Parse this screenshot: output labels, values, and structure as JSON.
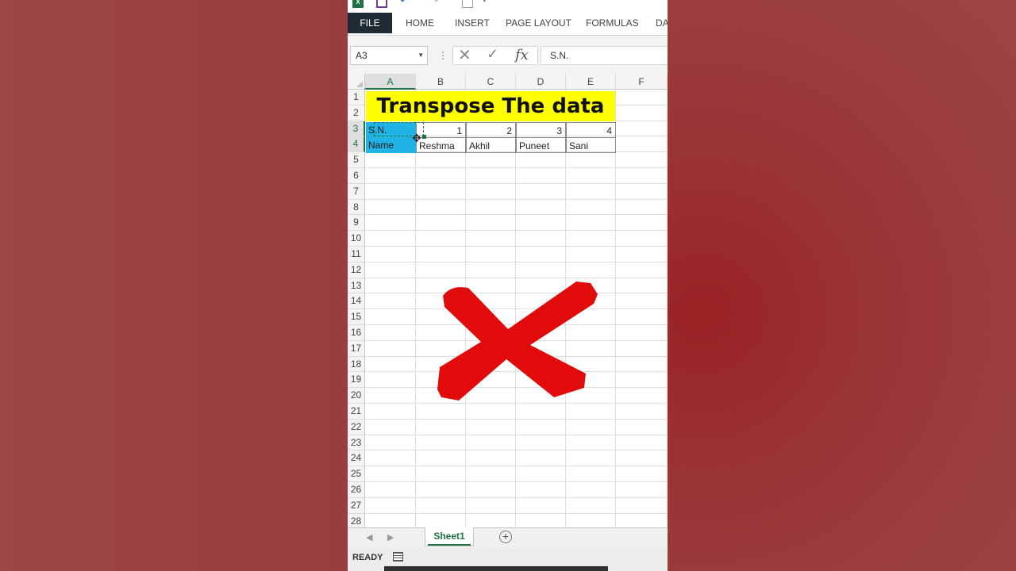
{
  "quick_access": {
    "app_icon": "excel-icon",
    "app_icon_text": "X",
    "save_icon": "save-icon",
    "undo_icon": "undo-icon",
    "redo_icon": "redo-icon"
  },
  "ribbon": {
    "tabs": [
      "FILE",
      "HOME",
      "INSERT",
      "PAGE LAYOUT",
      "FORMULAS",
      "DA"
    ]
  },
  "formula_bar": {
    "name_box": "A3",
    "formula": "S.N."
  },
  "columns": [
    "A",
    "B",
    "C",
    "D",
    "E",
    "F"
  ],
  "rows": [
    "1",
    "2",
    "3",
    "4",
    "5",
    "6",
    "7",
    "8",
    "9",
    "10",
    "11",
    "12",
    "13",
    "14",
    "15",
    "16",
    "17",
    "18",
    "19",
    "20",
    "21",
    "22",
    "23",
    "24",
    "25",
    "26",
    "27",
    "28"
  ],
  "sheet_title": "Transpose The data",
  "table": {
    "row3": [
      "S.N.",
      "1",
      "2",
      "3",
      "4"
    ],
    "row4": [
      "Name",
      "Reshma",
      "Akhil",
      "Puneet",
      "Sani"
    ]
  },
  "sheets": {
    "active": "Sheet1",
    "add_icon": "add-sheet-icon"
  },
  "status": {
    "mode": "READY"
  },
  "overlay": {
    "icon": "red-cross-icon",
    "color": "#e10b0b"
  },
  "colors": {
    "selection": "#1fb3e6",
    "title_fill": "#ffff00",
    "excel_green": "#217346"
  }
}
